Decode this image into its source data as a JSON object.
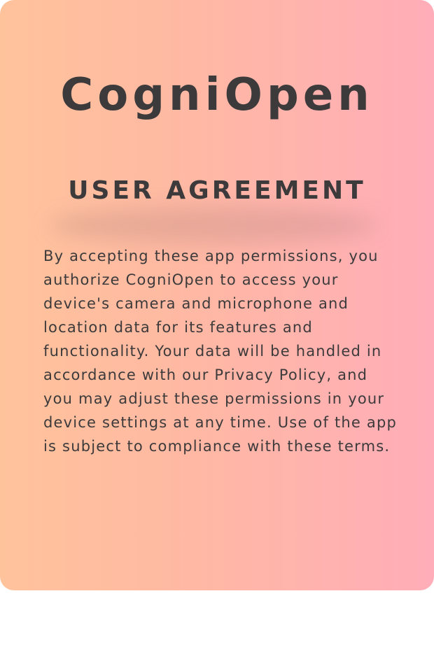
{
  "app": {
    "name": "CogniOpen"
  },
  "agreement": {
    "heading": "USER AGREEMENT",
    "body": "By accepting these app permissions, you authorize CogniOpen to access your device's camera and microphone and location data for its features and functionality. Your data will be handled in accordance with our Privacy Policy, and you may adjust these permissions in your device settings at any time. Use of the app is subject to compliance with these terms."
  },
  "colors": {
    "gradient_left": "#ffc39c",
    "gradient_right": "#ffadb8",
    "text": "#3c3a3b"
  }
}
